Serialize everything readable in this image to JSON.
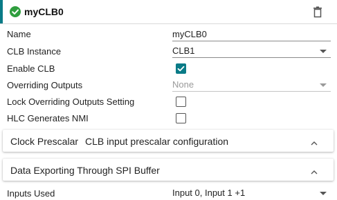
{
  "header": {
    "title": "myCLB0",
    "status_icon": "check-circle-icon",
    "status_color": "#2f9e3e",
    "delete_icon": "trash-icon",
    "accent_color": "#0a7b87"
  },
  "fields": {
    "name": {
      "label": "Name",
      "value": "myCLB0"
    },
    "clb_instance": {
      "label": "CLB Instance",
      "value": "CLB1"
    },
    "enable_clb": {
      "label": "Enable CLB",
      "checked": true
    },
    "overriding_outputs": {
      "label": "Overriding Outputs",
      "value": "None",
      "disabled": true
    },
    "lock_overriding": {
      "label": "Lock Overriding Outputs Setting",
      "checked": false
    },
    "hlc_nmi": {
      "label": "HLC Generates NMI",
      "checked": false
    },
    "inputs_used": {
      "label": "Inputs Used",
      "value": "Input 0, Input 1 +1"
    }
  },
  "sections": [
    {
      "title": "Clock Prescalar",
      "subtitle": "CLB input prescalar configuration",
      "expanded": true
    },
    {
      "title": "Data Exporting Through SPI Buffer",
      "subtitle": "",
      "expanded": true
    }
  ]
}
